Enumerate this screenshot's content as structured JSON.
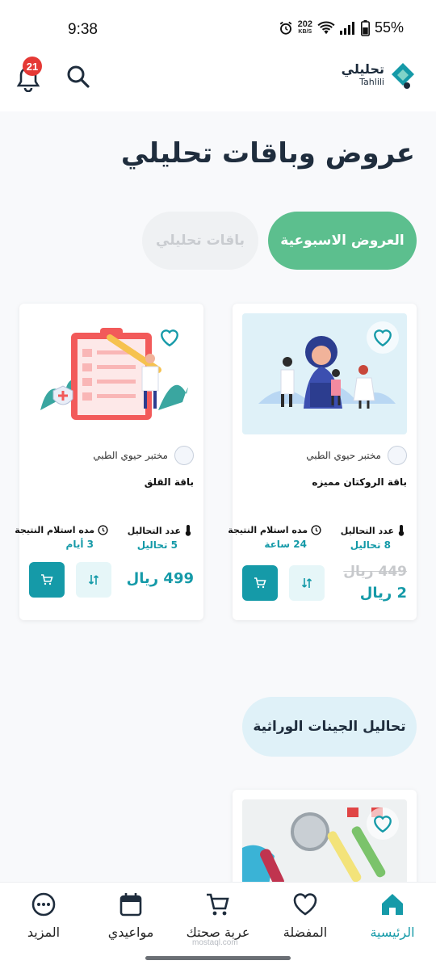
{
  "status_bar": {
    "time": "9:38",
    "net_speed": "202",
    "net_unit": "KB/S",
    "battery": "55%"
  },
  "header": {
    "notifications_count": "21",
    "logo_ar": "تحليلي",
    "logo_en": "Tahlili"
  },
  "page_title": "عروض وباقات تحليلي",
  "tabs": [
    {
      "label": "العروض الاسبوعية",
      "active": true
    },
    {
      "label": "باقات تحليلي",
      "active": false
    }
  ],
  "cards": [
    {
      "lab": "مختبر حيوي الطبي",
      "name": "باقة الروكتان مميزه",
      "stat_count_label": "عدد التحاليل",
      "stat_count_value": "8 تحاليل",
      "stat_time_label": "مده استلام النتيجة",
      "stat_time_value": "24 ساعة",
      "price_old": "449 ريال",
      "price": "2 ريال"
    },
    {
      "lab": "مختبر حيوي الطبي",
      "name": "باقة القلق",
      "stat_count_label": "عدد التحاليل",
      "stat_count_value": "5 تحاليل",
      "stat_time_label": "مده استلام النتيجة",
      "stat_time_value": "3 أيام",
      "price": "499 ريال"
    }
  ],
  "section": {
    "title": "تحاليل الجينات الوراثية"
  },
  "bottom_nav": [
    {
      "label": "الرئيسية",
      "icon": "home-icon",
      "active": true
    },
    {
      "label": "المفضلة",
      "icon": "heart-icon",
      "active": false
    },
    {
      "label": "عربة صحتك",
      "icon": "cart-icon",
      "active": false
    },
    {
      "label": "مواعيدي",
      "icon": "calendar-icon",
      "active": false
    },
    {
      "label": "المزيد",
      "icon": "more-icon",
      "active": false
    }
  ],
  "watermark": "mostaql.com",
  "colors": {
    "primary": "#159aa8",
    "tab_active": "#5cbf8e",
    "badge": "#e53935"
  }
}
